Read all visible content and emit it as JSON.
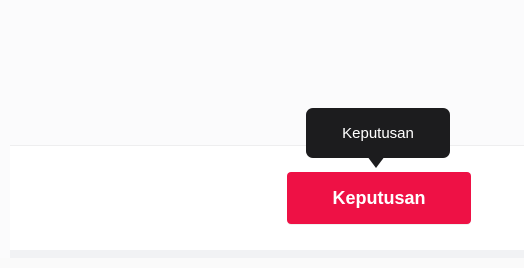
{
  "tooltip": {
    "text": "Keputusan"
  },
  "action": {
    "label": "Keputusan"
  },
  "colors": {
    "accent": "#ee1145",
    "tooltip_background": "#1c1c1e",
    "page_background": "#fbfbfc",
    "row_background": "#ffffff"
  }
}
